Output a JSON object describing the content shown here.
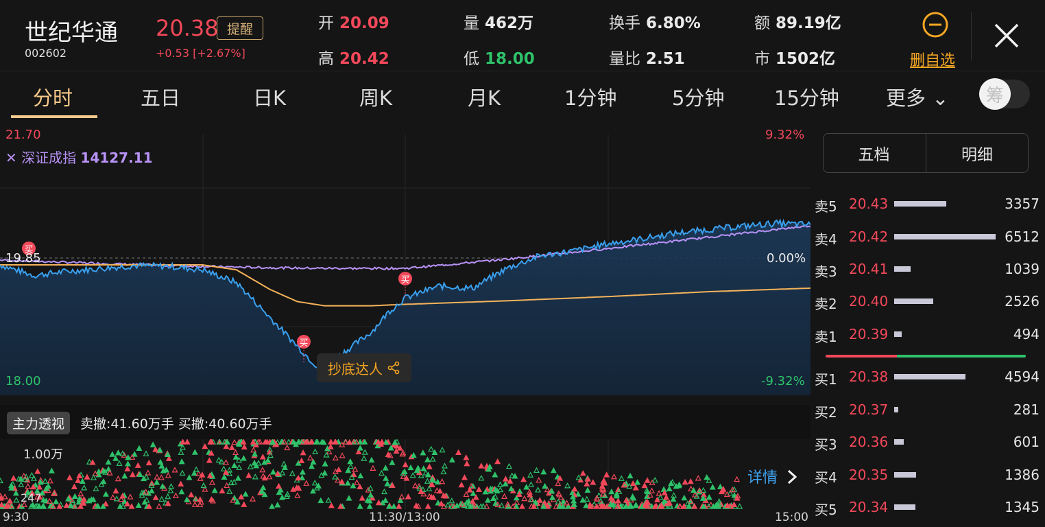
{
  "stock": {
    "name": "世纪华通",
    "code": "002602",
    "price": "20.38",
    "change": "+0.53 [+2.67%]",
    "alert_label": "提醒"
  },
  "stats": {
    "open": {
      "label": "开",
      "value": "20.09"
    },
    "high": {
      "label": "高",
      "value": "20.42"
    },
    "volume": {
      "label": "量",
      "value": "462万"
    },
    "low": {
      "label": "低",
      "value": "18.00"
    },
    "turnover": {
      "label": "换手",
      "value": "6.80%"
    },
    "vol_ratio": {
      "label": "量比",
      "value": "2.51"
    },
    "amount": {
      "label": "额",
      "value": "89.19亿"
    },
    "market_cap": {
      "label": "市",
      "value": "1502亿"
    }
  },
  "favorite": {
    "label": "删自选"
  },
  "tabs": [
    {
      "label": "分时",
      "active": true
    },
    {
      "label": "五日"
    },
    {
      "label": "日K"
    },
    {
      "label": "周K"
    },
    {
      "label": "月K"
    },
    {
      "label": "1分钟"
    },
    {
      "label": "5分钟"
    },
    {
      "label": "15分钟"
    },
    {
      "label": "更多 ⌄"
    }
  ],
  "toggle": {
    "label": "筹"
  },
  "chart": {
    "price_top": "21.70",
    "price_mid": "19.85",
    "price_bottom": "18.00",
    "pct_top": "9.32%",
    "pct_mid": "0.00%",
    "pct_bottom": "-9.32%",
    "index_name": "深证成指",
    "index_value": "14127.11",
    "buy_marker": "买",
    "bottom_button": "抄底达人",
    "colors": {
      "price_line": "#3aa0ee",
      "avg_line": "#f5b35a",
      "index_line": "#b993f7"
    }
  },
  "chart_data": {
    "type": "line",
    "ylim": [
      18.0,
      21.7
    ],
    "series": [
      {
        "name": "",
        "x": [
          0,
          10,
          20,
          30,
          40,
          50,
          60,
          70,
          80,
          88,
          92,
          96,
          100,
          105,
          110,
          115,
          120,
          130,
          140,
          150,
          160,
          170,
          180,
          190,
          200,
          210,
          220,
          230,
          240
        ],
        "values": [
          19.85,
          19.7,
          19.76,
          19.8,
          19.84,
          19.83,
          19.78,
          19.6,
          19.1,
          18.7,
          18.5,
          18.32,
          18.55,
          18.72,
          18.9,
          19.18,
          19.38,
          19.55,
          19.52,
          19.8,
          19.98,
          20.05,
          20.15,
          20.22,
          20.3,
          20.35,
          20.4,
          20.44,
          20.42
        ]
      },
      {
        "name": "",
        "x": [
          0,
          60,
          70,
          80,
          88,
          96,
          110,
          120,
          150,
          180,
          210,
          240
        ],
        "values": [
          19.85,
          19.85,
          19.78,
          19.5,
          19.33,
          19.27,
          19.27,
          19.29,
          19.34,
          19.4,
          19.47,
          19.52
        ]
      }
    ]
  },
  "main_force": {
    "tag": "主力透视",
    "text": "卖撤:41.60万手 买撤:40.60万手",
    "vol_top": "1.00万",
    "vol_bottom": "247",
    "detail": "详情"
  },
  "time_axis": {
    "start": "9:30",
    "mid": "11:30/13:00",
    "end": "15:00"
  },
  "order_book": {
    "tab_five": "五档",
    "tab_detail": "明细",
    "sell": [
      {
        "label": "卖5",
        "price": "20.43",
        "volume": "3357",
        "vol_num": 3357
      },
      {
        "label": "卖4",
        "price": "20.42",
        "volume": "6512",
        "vol_num": 6512
      },
      {
        "label": "卖3",
        "price": "20.41",
        "volume": "1039",
        "vol_num": 1039
      },
      {
        "label": "卖2",
        "price": "20.40",
        "volume": "2526",
        "vol_num": 2526
      },
      {
        "label": "卖1",
        "price": "20.39",
        "volume": "494",
        "vol_num": 494
      }
    ],
    "buy": [
      {
        "label": "买1",
        "price": "20.38",
        "volume": "4594",
        "vol_num": 4594
      },
      {
        "label": "买2",
        "price": "20.37",
        "volume": "281",
        "vol_num": 281
      },
      {
        "label": "买3",
        "price": "20.36",
        "volume": "601",
        "vol_num": 601
      },
      {
        "label": "买4",
        "price": "20.35",
        "volume": "1386",
        "vol_num": 1386
      },
      {
        "label": "买5",
        "price": "20.34",
        "volume": "1345",
        "vol_num": 1345
      }
    ]
  }
}
